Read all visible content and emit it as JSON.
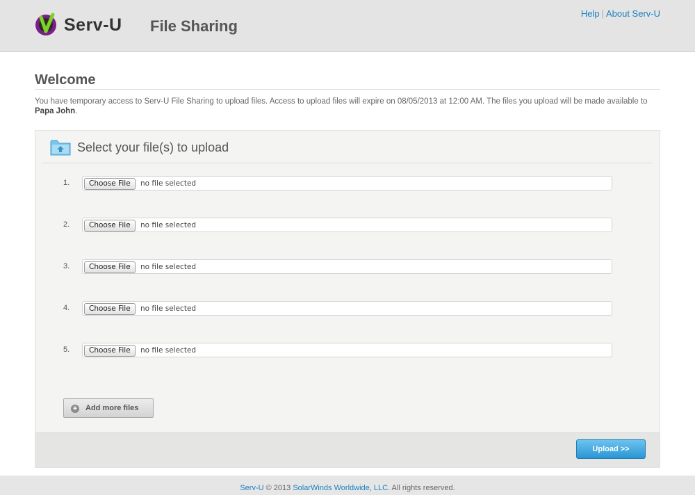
{
  "header": {
    "brand": "Serv-U",
    "app_title": "File Sharing",
    "links": {
      "help": "Help",
      "separator": "|",
      "about": "About Serv-U"
    }
  },
  "welcome": {
    "title": "Welcome",
    "intro_text": "You have temporary access to Serv-U File Sharing to upload files. Access to upload files will expire on 08/05/2013 at 12:00 AM. The files you upload will be made available to ",
    "recipient": "Papa John",
    "intro_end": "."
  },
  "upload_panel": {
    "title": "Select your file(s) to upload",
    "files": [
      {
        "num": "1.",
        "button": "Choose File",
        "status": "no file selected"
      },
      {
        "num": "2.",
        "button": "Choose File",
        "status": "no file selected"
      },
      {
        "num": "3.",
        "button": "Choose File",
        "status": "no file selected"
      },
      {
        "num": "4.",
        "button": "Choose File",
        "status": "no file selected"
      },
      {
        "num": "5.",
        "button": "Choose File",
        "status": "no file selected"
      }
    ],
    "add_more_label": "Add more files",
    "upload_label": "Upload >>"
  },
  "footer": {
    "product": "Serv-U",
    "copyright": " © 2013 ",
    "company": "SolarWinds Worldwide, LLC.",
    "rights": " All rights reserved."
  },
  "colors": {
    "link": "#1a7fc1",
    "upload_button": "#2b95d3",
    "logo_purple": "#7a1f8a",
    "logo_green": "#7cd322"
  }
}
